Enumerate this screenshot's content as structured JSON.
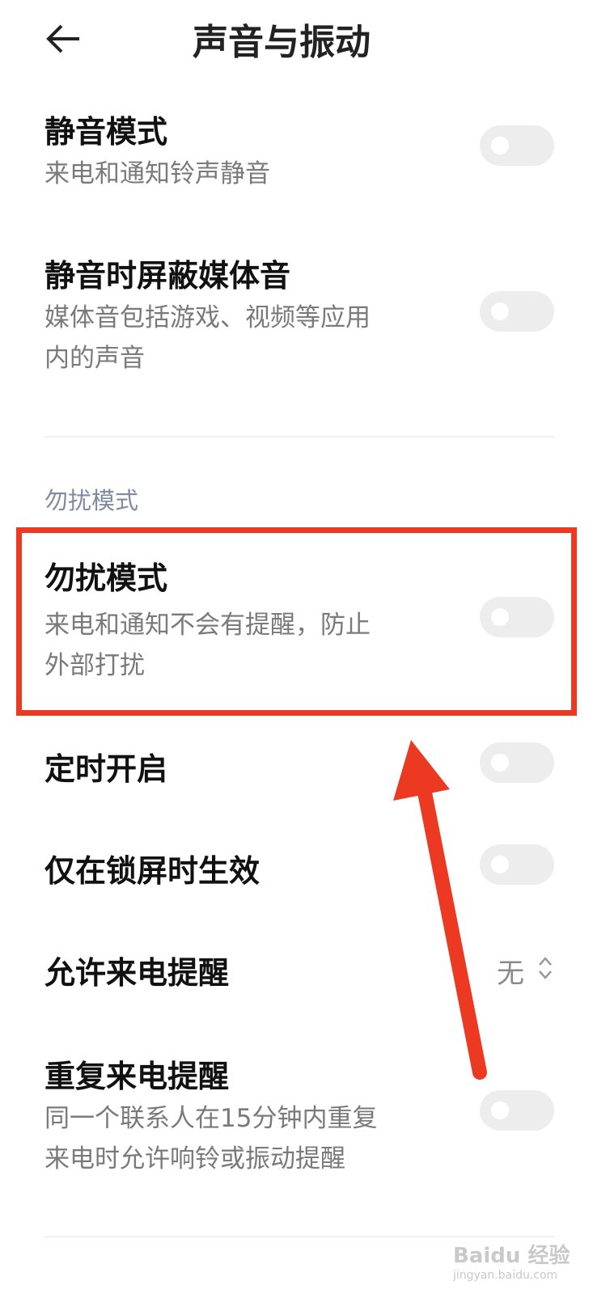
{
  "header": {
    "title": "声音与振动",
    "back_icon": "back-arrow-icon"
  },
  "items": [
    {
      "title": "静音模式",
      "subtitle": [
        "来电和通知铃声静音"
      ],
      "toggle": false
    },
    {
      "title": "静音时屏蔽媒体音",
      "subtitle": [
        "媒体音包括游戏、视频等应用",
        "内的声音"
      ],
      "toggle": false
    }
  ],
  "dnd_section": {
    "header": "勿扰模式",
    "items": [
      {
        "title": "勿扰模式",
        "subtitle": [
          "来电和通知不会有提醒，防止",
          "外部打扰"
        ],
        "toggle": false
      },
      {
        "title": "定时开启",
        "toggle": false
      },
      {
        "title": "仅在锁屏时生效",
        "toggle": false
      },
      {
        "title": "允许来电提醒",
        "value": "无"
      },
      {
        "title": "重复来电提醒",
        "subtitle": [
          "同一个联系人在15分钟内重复",
          "来电时允许响铃或振动提醒"
        ],
        "toggle": false
      }
    ]
  },
  "annotation": {
    "color": "#ec3a22"
  },
  "watermark": {
    "text": "Baidu 经验",
    "sub": "jingyan.baidu.com"
  }
}
